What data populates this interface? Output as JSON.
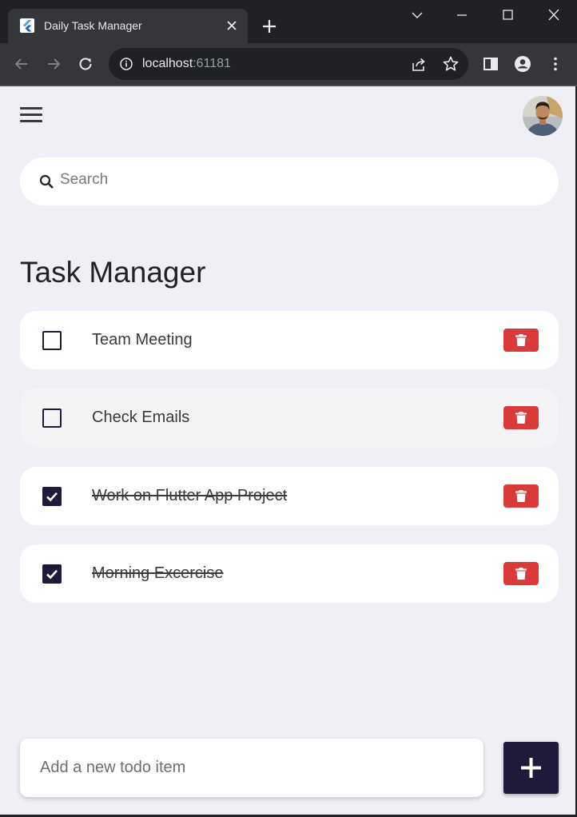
{
  "browser": {
    "tab_title": "Daily Task Manager",
    "url_host": "localhost",
    "url_port": ":61181"
  },
  "app": {
    "search_placeholder": "Search",
    "title": "Task Manager",
    "tasks": [
      {
        "label": "Team Meeting",
        "done": false
      },
      {
        "label": "Check Emails",
        "done": false
      },
      {
        "label": "Work on Flutter App Project",
        "done": true
      },
      {
        "label": "Morning Excercise",
        "done": true
      }
    ],
    "new_todo_placeholder": "Add a new todo item"
  },
  "colors": {
    "background": "#eef0f5",
    "primary": "#1e1b3a",
    "delete": "#d93b3b",
    "card": "#ffffff"
  }
}
